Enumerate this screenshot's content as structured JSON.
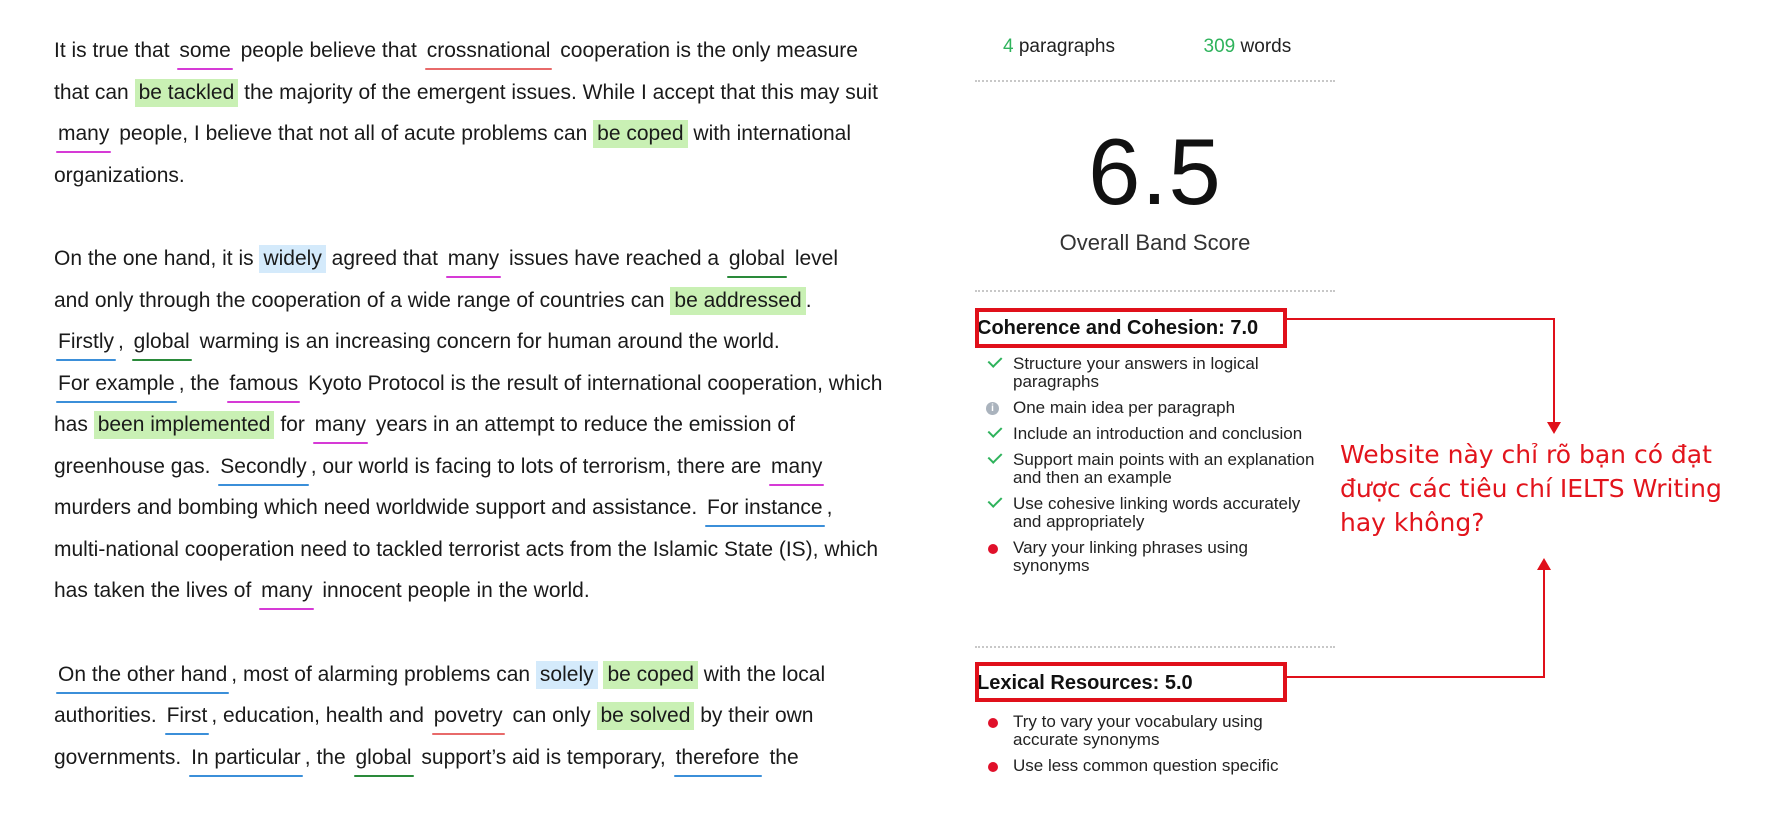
{
  "essay": {
    "paragraphs": [
      [
        [
          [
            "t",
            "It is true that "
          ],
          [
            "w",
            "some",
            "",
            "u-pink"
          ],
          [
            "t",
            " people believe that "
          ],
          [
            "w",
            "crossnational",
            "",
            "u-red"
          ],
          [
            "t",
            " cooperation is the only measure"
          ]
        ],
        [
          [
            "t",
            "that can "
          ],
          [
            "w",
            "be tackled",
            "green",
            ""
          ],
          [
            "t",
            " the majority of the emergent issues. While I accept that this may suit"
          ]
        ],
        [
          [
            "w",
            "many",
            "",
            "u-pink"
          ],
          [
            "t",
            " people, I believe that not all of acute problems can "
          ],
          [
            "w",
            "be coped",
            "green",
            ""
          ],
          [
            "t",
            " with international"
          ]
        ],
        [
          [
            "t",
            "organizations."
          ]
        ]
      ],
      [
        [
          [
            "t",
            "On the one hand, it is "
          ],
          [
            "w",
            "widely",
            "blue",
            ""
          ],
          [
            "t",
            " agreed that "
          ],
          [
            "w",
            "many",
            "",
            "u-pink"
          ],
          [
            "t",
            " issues have reached a "
          ],
          [
            "w",
            "global",
            "",
            "u-dgreen"
          ],
          [
            "t",
            " level"
          ]
        ],
        [
          [
            "t",
            "and only through the cooperation of a wide range of countries can "
          ],
          [
            "w",
            "be addressed",
            "green",
            ""
          ],
          [
            "t",
            "."
          ]
        ],
        [
          [
            "w",
            "Firstly",
            "",
            "u-blue"
          ],
          [
            "t",
            ", "
          ],
          [
            "w",
            "global",
            "",
            "u-dgreen"
          ],
          [
            "t",
            " warming is an increasing concern for human around the world."
          ]
        ],
        [
          [
            "w",
            "For example",
            "",
            "u-blue"
          ],
          [
            "t",
            ", the "
          ],
          [
            "w",
            "famous",
            "",
            "u-pink"
          ],
          [
            "t",
            " Kyoto Protocol is the result of international cooperation, which"
          ]
        ],
        [
          [
            "t",
            "has "
          ],
          [
            "w",
            "been implemented",
            "green",
            ""
          ],
          [
            "t",
            " for "
          ],
          [
            "w",
            "many",
            "",
            "u-pink"
          ],
          [
            "t",
            " years in an attempt to reduce the emission of"
          ]
        ],
        [
          [
            "t",
            "greenhouse gas. "
          ],
          [
            "w",
            "Secondly",
            "",
            "u-blue"
          ],
          [
            "t",
            ", our world is facing to lots of terrorism, there are "
          ],
          [
            "w",
            "many",
            "",
            "u-pink"
          ]
        ],
        [
          [
            "t",
            "murders and bombing which need worldwide support and assistance. "
          ],
          [
            "w",
            "For instance",
            "",
            "u-blue"
          ],
          [
            "t",
            ","
          ]
        ],
        [
          [
            "t",
            "multi-national cooperation need to tackled terrorist acts from the Islamic State (IS), which"
          ]
        ],
        [
          [
            "t",
            "has taken the lives of "
          ],
          [
            "w",
            "many",
            "",
            "u-pink"
          ],
          [
            "t",
            " innocent people in the world."
          ]
        ]
      ],
      [
        [
          [
            "w",
            "On the other hand",
            "",
            "u-blue"
          ],
          [
            "t",
            ", most of alarming problems can "
          ],
          [
            "w",
            "solely",
            "blue",
            ""
          ],
          [
            "t",
            " "
          ],
          [
            "w",
            "be coped",
            "green",
            ""
          ],
          [
            "t",
            " with the local"
          ]
        ],
        [
          [
            "t",
            "authorities. "
          ],
          [
            "w",
            "First",
            "",
            "u-blue"
          ],
          [
            "t",
            ", education, health and "
          ],
          [
            "w",
            "povetry",
            "",
            "u-red"
          ],
          [
            "t",
            " can only "
          ],
          [
            "w",
            "be solved",
            "green",
            ""
          ],
          [
            "t",
            " by their own"
          ]
        ],
        [
          [
            "t",
            "governments. "
          ],
          [
            "w",
            "In particular",
            "",
            "u-blue"
          ],
          [
            "t",
            ", the "
          ],
          [
            "w",
            "global",
            "",
            "u-dgreen"
          ],
          [
            "t",
            " support’s aid is temporary, "
          ],
          [
            "w",
            "therefore",
            "",
            "u-blue"
          ],
          [
            "t",
            " the"
          ]
        ]
      ]
    ]
  },
  "panel": {
    "paragraph_count": "4",
    "paragraph_label": "paragraphs",
    "word_count": "309",
    "word_label": "words",
    "overall_score": "6.5",
    "overall_label": "Overall Band Score",
    "coherence_title": "Coherence and Cohesion: 7.0",
    "coherence_items": [
      {
        "status": "check",
        "icon": "check-icon",
        "text": "Structure your answers in logical paragraphs"
      },
      {
        "status": "info",
        "icon": "info-icon",
        "text": "One main idea per paragraph"
      },
      {
        "status": "check",
        "icon": "check-icon",
        "text": "Include an introduction and conclusion"
      },
      {
        "status": "check",
        "icon": "check-icon",
        "text": "Support main points with an explanation and then an example"
      },
      {
        "status": "check",
        "icon": "check-icon",
        "text": "Use cohesive linking words accurately and appropriately"
      },
      {
        "status": "dot",
        "icon": "red-dot-icon",
        "text": "Vary your linking phrases using synonyms"
      }
    ],
    "lexical_title": "Lexical Resources: 5.0",
    "lexical_items": [
      {
        "status": "dot",
        "icon": "red-dot-icon",
        "text": "Try to vary your vocabulary using accurate synonyms"
      },
      {
        "status": "dot",
        "icon": "red-dot-icon",
        "text": "Use less common question specific"
      }
    ]
  },
  "annotation": {
    "note_line1": "Website này chỉ rõ bạn có đạt",
    "note_line2": "được các tiêu chí IELTS Writing",
    "note_line3": "hay không?",
    "accent_color": "#e0101a"
  },
  "colors": {
    "green_highlight": "#c9f0b4",
    "blue_highlight": "#d4eafb",
    "pink_underline": "#d63ad6",
    "red_underline": "#e86a6a",
    "blue_underline": "#3b8fd9",
    "dark_green_underline": "#2a8a3a",
    "count_green": "#2fb35c"
  }
}
